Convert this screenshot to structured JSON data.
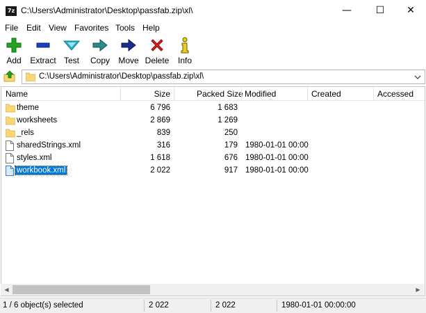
{
  "window": {
    "title": "C:\\Users\\Administrator\\Desktop\\passfab.zip\\xl\\",
    "app_icon_text": "7z",
    "controls": {
      "minimize": "—",
      "maximize": "☐",
      "close": "✕"
    }
  },
  "menu": [
    "File",
    "Edit",
    "View",
    "Favorites",
    "Tools",
    "Help"
  ],
  "toolbar": {
    "add": "Add",
    "extract": "Extract",
    "test": "Test",
    "copy": "Copy",
    "move": "Move",
    "delete": "Delete",
    "info": "Info"
  },
  "address": {
    "path": "C:\\Users\\Administrator\\Desktop\\passfab.zip\\xl\\"
  },
  "columns": {
    "name": "Name",
    "size": "Size",
    "packed": "Packed Size",
    "modified": "Modified",
    "created": "Created",
    "accessed": "Accessed"
  },
  "files": [
    {
      "name": "theme",
      "type": "folder",
      "size": "6 796",
      "packed": "1 683",
      "modified": ""
    },
    {
      "name": "worksheets",
      "type": "folder",
      "size": "2 869",
      "packed": "1 269",
      "modified": ""
    },
    {
      "name": "_rels",
      "type": "folder",
      "size": "839",
      "packed": "250",
      "modified": ""
    },
    {
      "name": "sharedStrings.xml",
      "type": "file",
      "size": "316",
      "packed": "179",
      "modified": "1980-01-01 00:00"
    },
    {
      "name": "styles.xml",
      "type": "file",
      "size": "1 618",
      "packed": "676",
      "modified": "1980-01-01 00:00"
    },
    {
      "name": "workbook.xml",
      "type": "file",
      "size": "2 022",
      "packed": "917",
      "modified": "1980-01-01 00:00",
      "selected": true
    }
  ],
  "status": {
    "selection": "1 / 6 object(s) selected",
    "size": "2 022",
    "packed": "2 022",
    "modified": "1980-01-01 00:00:00"
  },
  "colors": {
    "selection": "#0078d7",
    "folder": "#f8d775",
    "add_green": "#1fa51f",
    "extract_blue": "#1e3fbf",
    "test_cyan": "#22b5c9",
    "copy_teal": "#2a8a8a",
    "move_navy": "#1c2c8c",
    "delete_red": "#d42020",
    "info_yellow": "#e8d020"
  }
}
